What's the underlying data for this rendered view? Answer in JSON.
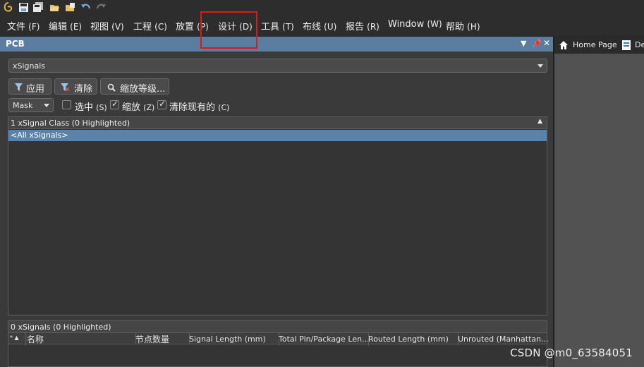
{
  "toolbar": {
    "icons": [
      "app-logo-icon",
      "save-icon",
      "save-all-icon",
      "open-folder-icon",
      "open-project-icon",
      "undo-icon",
      "redo-icon"
    ]
  },
  "menubar": {
    "items": [
      {
        "label": "文件",
        "acc": "(F)"
      },
      {
        "label": "编辑",
        "acc": "(E)"
      },
      {
        "label": "视图",
        "acc": "(V)"
      },
      {
        "label": "工程",
        "acc": "(C)"
      },
      {
        "label": "放置",
        "acc": "(P)"
      },
      {
        "label": "设计",
        "acc": "(D)"
      },
      {
        "label": "工具",
        "acc": "(T)"
      },
      {
        "label": "布线",
        "acc": "(U)"
      },
      {
        "label": "报告",
        "acc": "(R)"
      },
      {
        "label": "Window",
        "acc": "(W)"
      },
      {
        "label": "帮助",
        "acc": "(H)"
      }
    ]
  },
  "panel": {
    "title": "PCB",
    "object_select": {
      "value": "xSignals"
    },
    "buttons": {
      "apply": "应用",
      "clear": "清除",
      "zoom_level": "缩放等级..."
    },
    "mode_select": {
      "value": "Mask"
    },
    "checkboxes": [
      {
        "label": "选中",
        "acc": "(S)",
        "checked": false
      },
      {
        "label": "缩放",
        "acc": "(Z)",
        "checked": true
      },
      {
        "label": "清除现有的",
        "acc": "(C)",
        "checked": true
      }
    ],
    "class_list": {
      "header": "1 xSignal Class (0 Highlighted)",
      "rows": [
        "<All xSignals>"
      ]
    },
    "signal_list": {
      "header": "0 xSignals (0 Highlighted)",
      "columns": [
        "名称",
        "节点数量",
        "Signal Length (mm)",
        "Total Pin/Package Len...",
        "Routed Length (mm)",
        "Unrouted (Manhattan..."
      ]
    }
  },
  "right_tabs": [
    {
      "label": "Home Page"
    },
    {
      "label": "De"
    }
  ],
  "watermark": "CSDN @m0_63584051",
  "colors": {
    "panel_title": "#5b7da0",
    "selection": "#5a82ab",
    "highlight_box": "#e01818"
  }
}
